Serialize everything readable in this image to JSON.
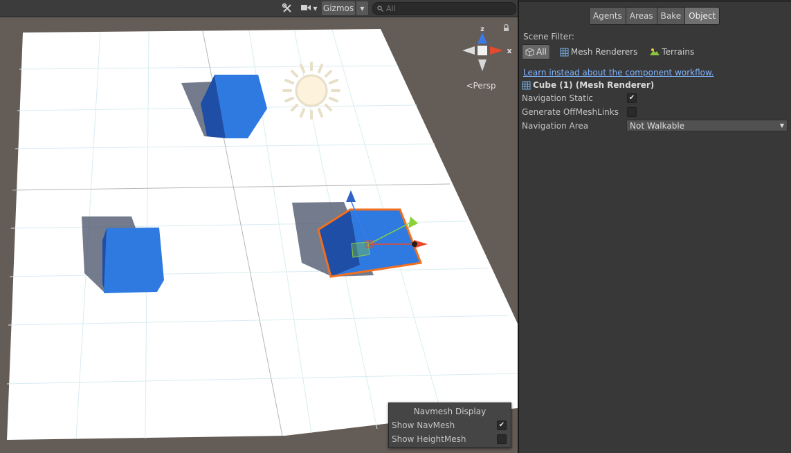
{
  "scene": {
    "toolbar": {
      "tools_icon": "wrench-crossed-icon",
      "camera_icon": "video-camera-icon",
      "gizmos_label": "Gizmos",
      "search_placeholder": "All"
    },
    "axis_gizmo": {
      "z_label": "z",
      "x_label": "x",
      "projection_label": "<Persp",
      "colors": {
        "x": "#e64a2e",
        "y": "#8ad23a",
        "z": "#3a7ae6"
      }
    },
    "floor_color": "#ffffff",
    "cube_color": "#2f7ae0",
    "selection_outline_color": "#f07020",
    "navmesh_display": {
      "title": "Navmesh Display",
      "show_navmesh_label": "Show NavMesh",
      "show_navmesh_checked": true,
      "show_heightmesh_label": "Show HeightMesh",
      "show_heightmesh_checked": false
    }
  },
  "navigation": {
    "tabs": [
      {
        "label": "Agents",
        "active": false
      },
      {
        "label": "Areas",
        "active": false
      },
      {
        "label": "Bake",
        "active": false
      },
      {
        "label": "Object",
        "active": true
      }
    ],
    "scene_filter_label": "Scene Filter:",
    "filters": [
      {
        "label": "All",
        "icon": "cube-outline-icon",
        "active": true
      },
      {
        "label": "Mesh Renderers",
        "icon": "mesh-grid-icon",
        "active": false
      },
      {
        "label": "Terrains",
        "icon": "terrain-icon",
        "active": false
      }
    ],
    "component_link": "Learn instead about the component workflow.",
    "component_header": "Cube (1) (Mesh Renderer)",
    "properties": {
      "navigation_static_label": "Navigation Static",
      "navigation_static_checked": true,
      "generate_offmeshlinks_label": "Generate OffMeshLinks",
      "generate_offmeshlinks_checked": false,
      "navigation_area_label": "Navigation Area",
      "navigation_area_value": "Not Walkable"
    }
  }
}
